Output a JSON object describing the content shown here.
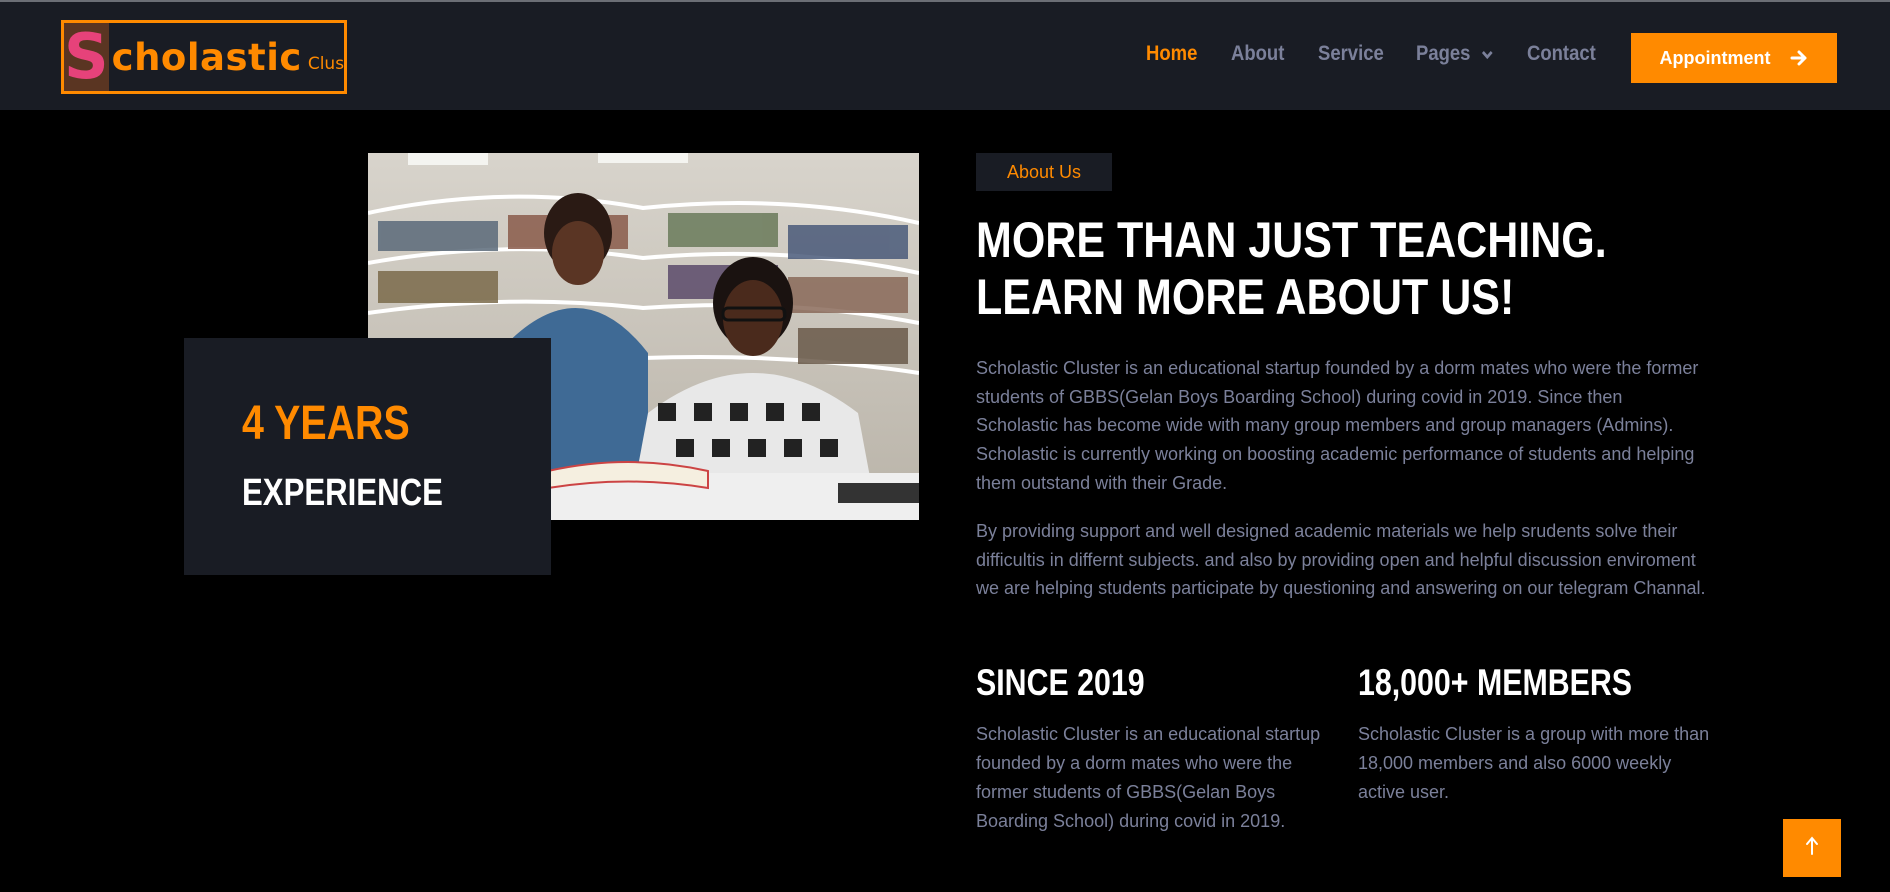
{
  "header": {
    "logo": {
      "letter": "S",
      "word": "cholastic",
      "sub": "Cluster"
    },
    "nav": [
      {
        "label": "Home",
        "active": true
      },
      {
        "label": "About"
      },
      {
        "label": "Service"
      },
      {
        "label": "Pages",
        "has_dropdown": true,
        "icon": "chevron-down-icon"
      },
      {
        "label": "Contact"
      }
    ],
    "appointment_label": "Appointment",
    "appointment_icon": "arrow-right-icon"
  },
  "experience": {
    "years": "4 YEARS",
    "label": "EXPERIENCE"
  },
  "photo": {
    "description_icon": "students-studying-photo"
  },
  "about": {
    "badge": "About Us",
    "headline": "MORE THAN JUST TEACHING. LEARN MORE ABOUT US!",
    "paragraph1": "Scholastic Cluster is an educational startup founded by a dorm mates who were the former students of GBBS(Gelan Boys Boarding School) during covid in 2019. Since then Scholastic has become wide with many group members and group managers (Admins). Scholastic is currently working on boosting academic performance of students and helping them outstand with their Grade.",
    "paragraph2": "By providing support and well designed academic materials we help srudents solve their difficultis in differnt subjects. and also by providing open and helpful discussion enviroment we are helping students participate by questioning and answering on our telegram Channal."
  },
  "stats": [
    {
      "title": "SINCE 2019",
      "text": "Scholastic Cluster is an educational startup founded by a dorm mates who were the former students of GBBS(Gelan Boys Boarding School) during covid in 2019."
    },
    {
      "title": "18,000+ MEMBERS",
      "text": "Scholastic Cluster is a group with more than 18,000 members and also 6000 weekly active user."
    }
  ],
  "scroll_top_icon": "arrow-up-icon",
  "colors": {
    "accent": "#ff8a00",
    "panel": "#191c24",
    "background": "#000000",
    "muted_text": "#7b809a"
  }
}
